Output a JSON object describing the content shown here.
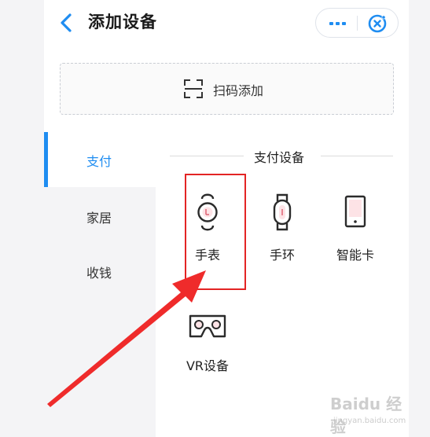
{
  "header": {
    "title": "添加设备",
    "back_icon": "chevron-left-icon",
    "more_icon": "more-dots-icon",
    "close_icon": "close-circle-icon",
    "accent_color": "#1f8df1"
  },
  "scan": {
    "label": "扫码添加",
    "icon": "scan-icon"
  },
  "sidebar": {
    "items": [
      {
        "label": "支付",
        "active": true
      },
      {
        "label": "家居",
        "active": false
      },
      {
        "label": "收钱",
        "active": false
      }
    ]
  },
  "section": {
    "title": "支付设备"
  },
  "devices": [
    {
      "label": "手表",
      "icon": "watch-icon"
    },
    {
      "label": "手环",
      "icon": "band-icon"
    },
    {
      "label": "智能卡",
      "icon": "smart-card-icon"
    },
    {
      "label": "VR设备",
      "icon": "vr-headset-icon"
    }
  ],
  "annotation": {
    "color": "#e32424"
  },
  "watermark": {
    "text": "Baidu 经验",
    "url": "jingyan.baidu.com"
  }
}
